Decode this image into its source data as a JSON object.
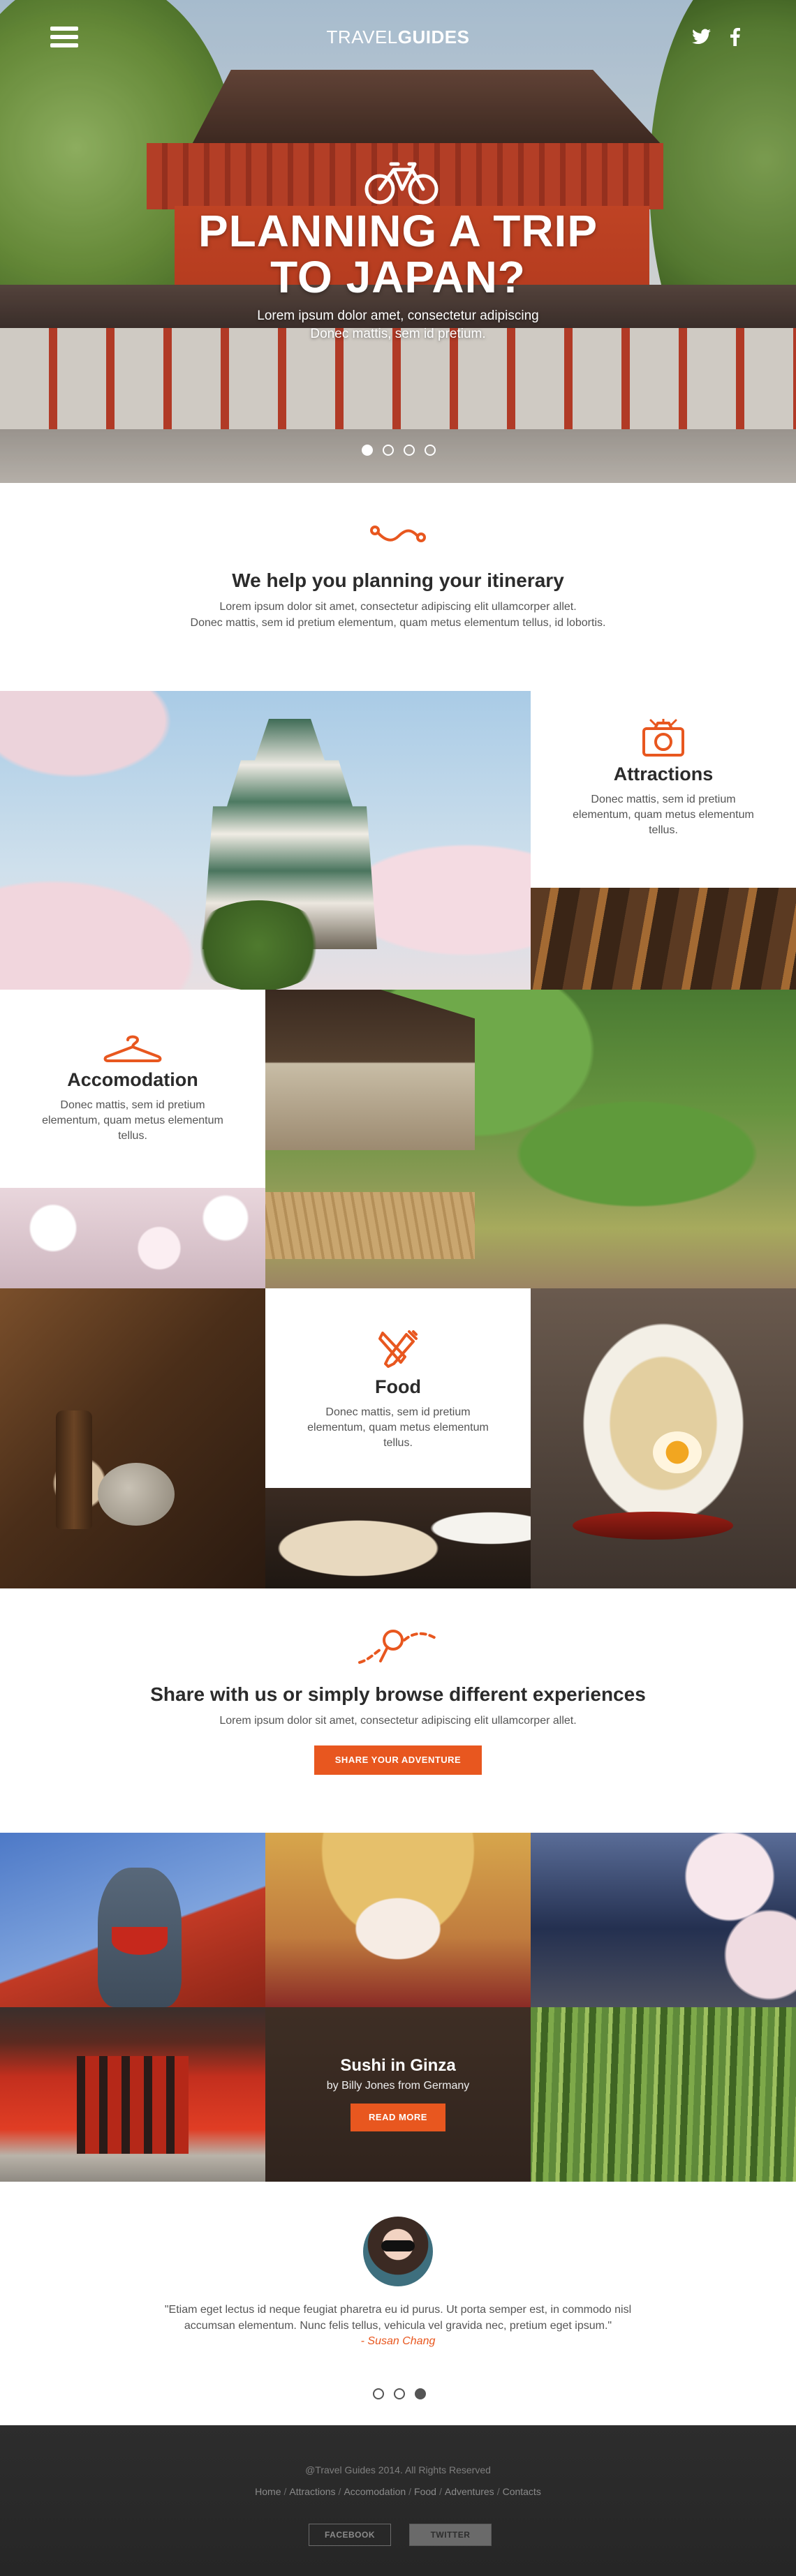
{
  "colors": {
    "accent": "#e8571f",
    "footer_bg": "#2d2d2d",
    "heading": "#2b2b2b"
  },
  "header": {
    "brand_light": "TRAVEL",
    "brand_bold": "GUIDES",
    "menu_icon": "hamburger-icon",
    "social": [
      "twitter-icon",
      "facebook-icon"
    ]
  },
  "hero": {
    "icon": "bicycle-icon",
    "title_line1": "PLANNING A TRIP",
    "title_line2": "TO JAPAN?",
    "subtitle_line1": "Lorem ipsum dolor amet, consectetur adipiscing",
    "subtitle_line2": "Donec mattis, sem id pretium.",
    "slides": 4,
    "active_slide": 1
  },
  "itinerary": {
    "icon": "route-icon",
    "title": "We help you planning your itinerary",
    "text_line1": "Lorem ipsum dolor sit amet, consectetur adipiscing elit ullamcorper allet.",
    "text_line2": "Donec mattis, sem id pretium elementum, quam metus elementum tellus, id lobortis."
  },
  "categories": [
    {
      "name": "Attractions",
      "icon": "camera-icon",
      "text": "Donec mattis, sem id pretium elementum, quam metus elementum tellus."
    },
    {
      "name": "Accomodation",
      "icon": "hanger-icon",
      "text": "Donec mattis, sem id pretium elementum, quam metus elementum tellus."
    },
    {
      "name": "Food",
      "icon": "fork-knife-icon",
      "text": "Donec mattis, sem id pretium elementum, quam metus elementum tellus."
    }
  ],
  "share": {
    "icon": "map-pin-path-icon",
    "title": "Share with us or simply browse different experiences",
    "text": "Lorem ipsum dolor sit amet, consectetur adipiscing elit ullamcorper allet.",
    "button": "SHARE YOUR ADVENTURE"
  },
  "featured": {
    "title": "Sushi in Ginza",
    "byline": "by Billy Jones from Germany",
    "button": "READ MORE"
  },
  "testimonial": {
    "quote_line1": "\"Etiam eget lectus id neque feugiat pharetra eu id purus. Ut porta semper est, in commodo nisl",
    "quote_line2": "accumsan elementum. Nunc felis tellus, vehicula vel gravida nec, pretium eget ipsum.\"",
    "author": "- Susan Chang",
    "slides": 3,
    "active_slide": 3
  },
  "footer": {
    "copyright": "@Travel Guides 2014. All Rights Reserved",
    "links": [
      "Home",
      "Attractions",
      "Accomodation",
      "Food",
      "Adventures",
      "Contacts"
    ],
    "separator": "/",
    "buttons": [
      "FACEBOOK",
      "TWITTER"
    ]
  }
}
